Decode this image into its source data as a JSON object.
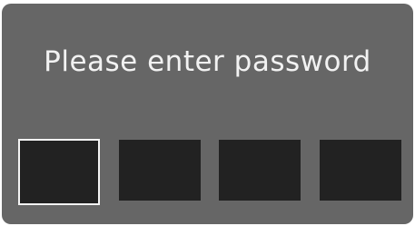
{
  "dialog": {
    "prompt": "Please enter password",
    "pin_boxes": [
      {
        "value": "",
        "focused": true
      },
      {
        "value": "",
        "focused": false
      },
      {
        "value": "",
        "focused": false
      },
      {
        "value": "",
        "focused": false
      }
    ]
  },
  "colors": {
    "dialog_background": "#666666",
    "prompt_text": "#f2f2f2",
    "box_fill": "#222222",
    "focus_border": "#f4f4f4"
  }
}
